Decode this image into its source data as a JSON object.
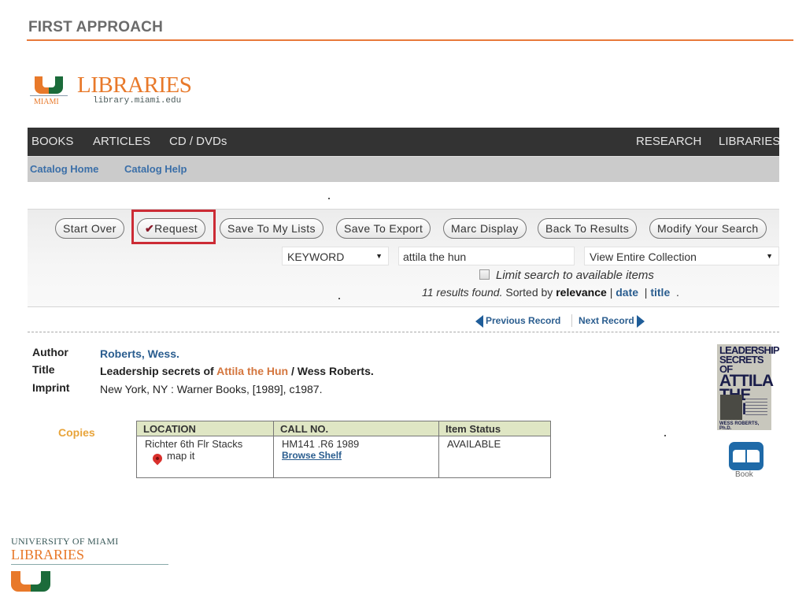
{
  "slide": {
    "title": "FIRST APPROACH"
  },
  "logo": {
    "u_caption": "MIAMI",
    "name": "LIBRARIES",
    "url": "library.miami.edu"
  },
  "topnav": {
    "left": [
      "BOOKS",
      "ARTICLES",
      "CD / DVDs"
    ],
    "right": [
      "RESEARCH",
      "LIBRARIES"
    ]
  },
  "subnav": [
    "Catalog Home",
    "Catalog Help"
  ],
  "toolbar": {
    "buttons": [
      "Start Over",
      "Request",
      "Save To My Lists",
      "Save To Export",
      "Marc Display",
      "Back To Results",
      "Modify Your Search"
    ],
    "request_check": "✔",
    "search_type": "KEYWORD",
    "search_value": "attila  the hun",
    "collection": "View Entire Collection",
    "limit_label": "Limit search to available items",
    "limit_checked": false,
    "results_count": "11 results found.",
    "sorted_by_label": "Sorted by",
    "sort_current": "relevance",
    "sort_options": [
      "date",
      "title"
    ]
  },
  "record_nav": {
    "previous": "Previous Record",
    "next": "Next Record"
  },
  "record": {
    "author_label": "Author",
    "author": "Roberts, Wess.",
    "title_label": "Title",
    "title_prefix": "Leadership secrets of ",
    "title_highlight": "Attila the Hun",
    "title_suffix": " / Wess Roberts.",
    "imprint_label": "Imprint",
    "imprint": "New York, NY : Warner Books, [1989], c1987."
  },
  "copies": {
    "label": "Copies",
    "headers": [
      "LOCATION",
      "CALL NO.",
      "Item Status"
    ],
    "rows": [
      {
        "location": "Richter 6th Flr Stacks",
        "map_link": "map it",
        "call_no": "HM141 .R6 1989",
        "browse_link": "Browse Shelf",
        "status": "AVAILABLE"
      }
    ]
  },
  "cover": {
    "line1": "LEADERSHIP",
    "line2": "SECRETS OF",
    "line3": "ATTILA",
    "line4": "THE HUN",
    "author": "WESS ROBERTS, Ph.D."
  },
  "format": {
    "label": "Book"
  },
  "footer": {
    "university": "UNIVERSITY OF MIAMI",
    "libraries": "LIBRARIES"
  },
  "colors": {
    "accent_orange": "#e8792a",
    "accent_green": "#1b6b3a",
    "highlight_red": "#cc2b35",
    "link_blue": "#2a5d8f"
  }
}
